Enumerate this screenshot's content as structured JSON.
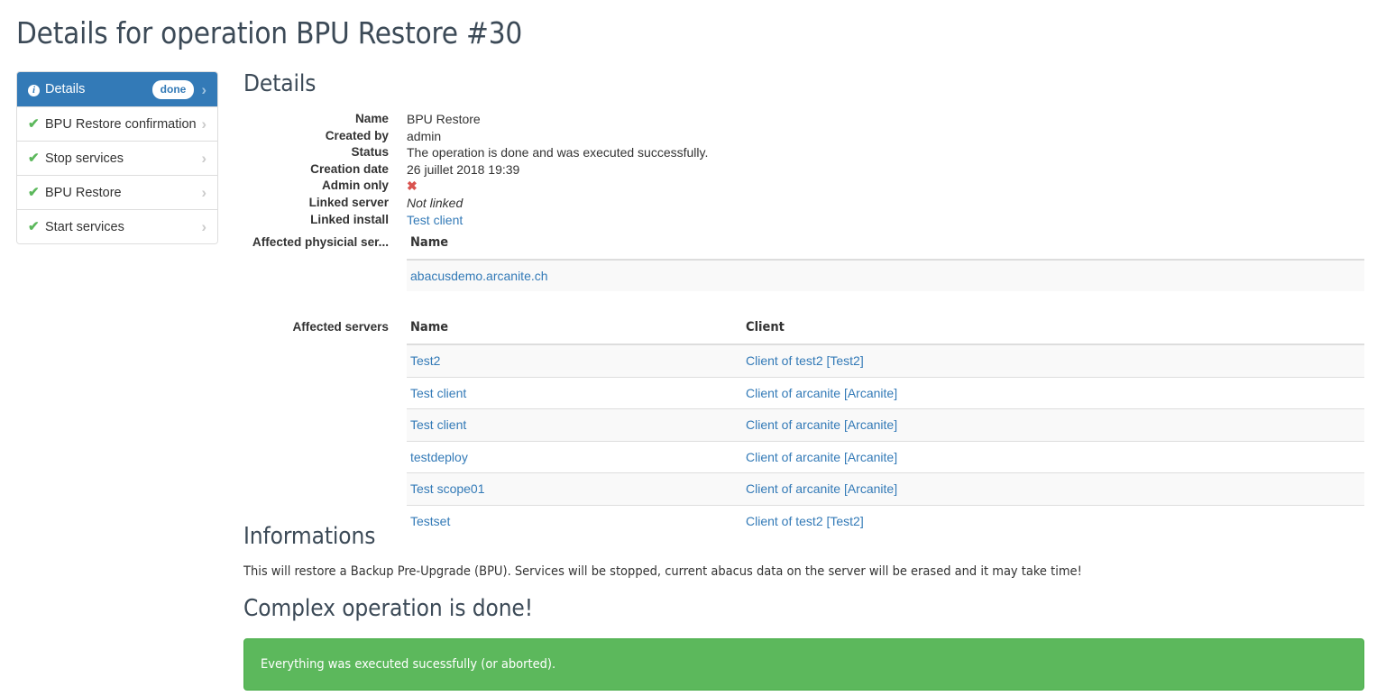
{
  "page": {
    "title": "Details for operation BPU Restore #30"
  },
  "colors": {
    "primary": "#337ab7",
    "success": "#5cb85c",
    "danger": "#d9534f",
    "heading": "#3c4a57",
    "link": "#337ab7",
    "row_stripe": "#f9f9f9",
    "border": "#dddddd"
  },
  "sidebar": {
    "items": [
      {
        "label": "Details",
        "icon": "info-icon",
        "badge": "done",
        "active": true
      },
      {
        "label": "BPU Restore confirmation",
        "icon": "check-icon",
        "badge": "",
        "active": false
      },
      {
        "label": "Stop services",
        "icon": "check-icon",
        "badge": "",
        "active": false
      },
      {
        "label": "BPU Restore",
        "icon": "check-icon",
        "badge": "",
        "active": false
      },
      {
        "label": "Start services",
        "icon": "check-icon",
        "badge": "",
        "active": false
      }
    ]
  },
  "details": {
    "heading": "Details",
    "fields": [
      {
        "term": "Name",
        "value": "BPU Restore"
      },
      {
        "term": "Created by",
        "value": "admin"
      },
      {
        "term": "Status",
        "value": "The operation is done and was executed successfully."
      },
      {
        "term": "Creation date",
        "value": "26 juillet 2018 19:39"
      },
      {
        "term": "Admin only",
        "value": "✖"
      },
      {
        "term": "Linked server",
        "value": "Not linked"
      },
      {
        "term": "Linked install",
        "value": "Test client"
      }
    ],
    "physical_servers": {
      "term": "Affected physicial ser...",
      "columns": [
        "Name"
      ],
      "rows": [
        {
          "name": "abacusdemo.arcanite.ch"
        }
      ]
    },
    "affected_servers": {
      "term": "Affected servers",
      "columns": [
        "Name",
        "Client"
      ],
      "rows": [
        {
          "name": "Test2",
          "client": "Client of test2 [Test2]"
        },
        {
          "name": "Test client",
          "client": "Client of arcanite [Arcanite]"
        },
        {
          "name": "Test client",
          "client": "Client of arcanite [Arcanite]"
        },
        {
          "name": "testdeploy",
          "client": "Client of arcanite [Arcanite]"
        },
        {
          "name": "Test scope01",
          "client": "Client of arcanite [Arcanite]"
        },
        {
          "name": "Testset",
          "client": "Client of test2 [Test2]"
        }
      ]
    }
  },
  "informations": {
    "heading": "Informations",
    "paragraph": "This will restore a Backup Pre-Upgrade (BPU). Services will be stopped, current abacus data on the server will be erased and it may take time!"
  },
  "result": {
    "heading": "Complex operation is done!",
    "alert_text": "Everything was executed sucessfully (or aborted)."
  }
}
